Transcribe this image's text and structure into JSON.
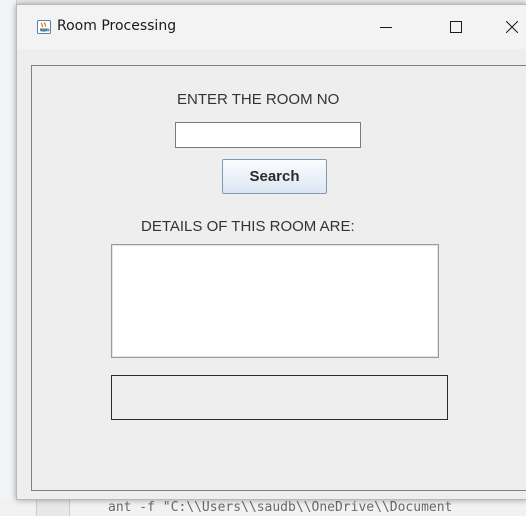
{
  "window": {
    "title": "Room Processing",
    "controls": [
      "minimize",
      "maximize",
      "close"
    ]
  },
  "form": {
    "room_label": "ENTER THE ROOM NO",
    "room_input_value": "",
    "search_label": "Search",
    "details_label": "DETAILS OF THIS ROOM ARE:",
    "details_text": "",
    "result_text": ""
  },
  "background": {
    "code_line": "ant -f \"C:\\\\Users\\\\saudb\\\\OneDrive\\\\Document"
  },
  "icons": [
    "java-app-icon",
    "minimize-icon",
    "maximize-icon",
    "close-icon"
  ]
}
